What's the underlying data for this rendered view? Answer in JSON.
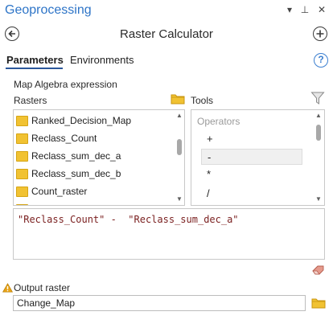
{
  "pane": {
    "title": "Geoprocessing",
    "controls": {
      "menu": "▾",
      "pin": "⊥",
      "close": "✕"
    }
  },
  "tool": {
    "title": "Raster Calculator"
  },
  "tabs": [
    {
      "label": "Parameters",
      "active": true
    },
    {
      "label": "Environments",
      "active": false
    }
  ],
  "help_label": "?",
  "expression_section": {
    "label": "Map Algebra expression",
    "rasters_label": "Rasters",
    "tools_label": "Tools",
    "rasters": [
      "Ranked_Decision_Map",
      "Reclass_Count",
      "Reclass_sum_dec_a",
      "Reclass_sum_dec_b",
      "Count_raster"
    ],
    "operators_header": "Operators",
    "operators": [
      "+",
      "-",
      "*",
      "/"
    ],
    "selected_operator": "-",
    "expression": "\"Reclass_Count\" -  \"Reclass_sum_dec_a\""
  },
  "output": {
    "label": "Output raster",
    "value": "Change_Map"
  },
  "colors": {
    "accent": "#2d74c7",
    "folder": "#f1c232",
    "expression_text": "#7a1f1f",
    "warning": "#e8a317"
  }
}
